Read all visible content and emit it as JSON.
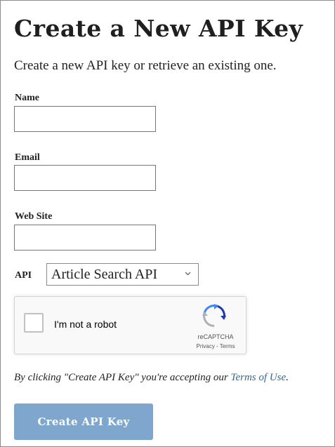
{
  "page": {
    "title": "Create a New API Key",
    "subtitle": "Create a new API key or retrieve an existing one."
  },
  "form": {
    "name_label": "Name",
    "name_value": "",
    "email_label": "Email",
    "email_value": "",
    "website_label": "Web Site",
    "website_value": "",
    "api_label": "API",
    "api_selected": "Article Search API"
  },
  "recaptcha": {
    "label": "I'm not a robot",
    "brand": "reCAPTCHA",
    "privacy_link": "Privacy",
    "separator": " - ",
    "terms_link": "Terms",
    "checked": false
  },
  "terms": {
    "prefix": "By clicking \"Create API Key\" you're accepting our ",
    "link": "Terms of Use",
    "suffix": "."
  },
  "submit": {
    "label": "Create API Key"
  },
  "icons": {
    "select_chevron": "chevron-down-icon",
    "recaptcha_logo": "recaptcha-logo-icon"
  },
  "colors": {
    "link": "#326891",
    "button_bg": "#7fa6cd",
    "button_text": "#ffffff",
    "border": "#767676"
  }
}
